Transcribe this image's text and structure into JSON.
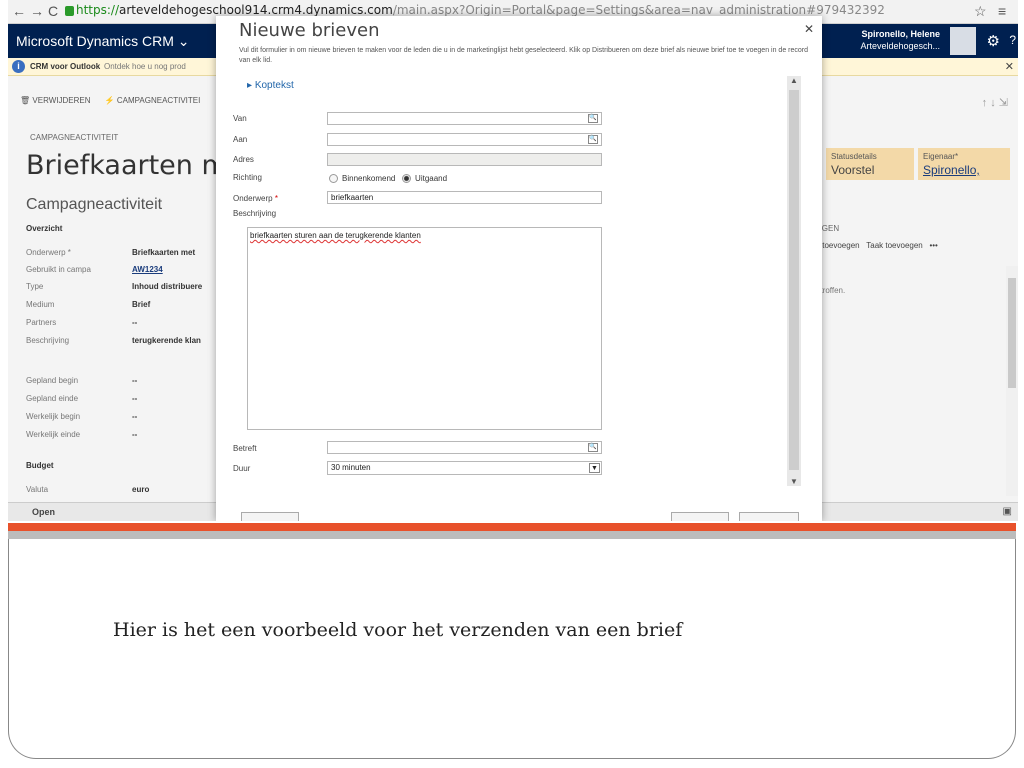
{
  "browser": {
    "url_https": "https://",
    "url_domain": "arteveldehogeschool914.crm4.dynamics.com",
    "url_rest": "/main.aspx?Origin=Portal&page=Settings&area=nav_administration#979432392"
  },
  "crm": {
    "brand": "Microsoft Dynamics CRM",
    "user_name": "Spironello, Helene",
    "user_org": "Arteveldehogesch..."
  },
  "notice": {
    "title": "CRM voor Outlook",
    "text": "Ontdek hoe u nog prod"
  },
  "record": {
    "cmd_delete": "VERWIJDEREN",
    "cmd_campaign": "CAMPAGNEACTIVITEI",
    "entity": "CAMPAGNEACTIVITEIT",
    "title": "Briefkaarten me",
    "section": "Campagneactiviteit",
    "overview": "Overzicht",
    "fields": [
      {
        "label": "Onderwerp *",
        "value": "Briefkaarten met"
      },
      {
        "label": "Gebruikt in campa",
        "value": "AW1234"
      },
      {
        "label": "Type",
        "value": "Inhoud distribuere"
      },
      {
        "label": "Medium",
        "value": "Brief"
      },
      {
        "label": "Partners",
        "value": "--"
      },
      {
        "label": "Beschrijving",
        "value": "terugkerende klan"
      },
      {
        "label": "Gepland begin",
        "value": "--"
      },
      {
        "label": "Gepland einde",
        "value": "--"
      },
      {
        "label": "Werkelijk begin",
        "value": "--"
      },
      {
        "label": "Werkelijk einde",
        "value": "--"
      }
    ],
    "budget": "Budget",
    "currency_label": "Valuta",
    "currency_value": "euro",
    "status_label": "Statusdetails",
    "status_value": "Voorstel",
    "owner_label": "Eigenaar*",
    "owner_value": "Spironello,",
    "right_section": "NGEN",
    "right_action1": "k toevoegen",
    "right_action2": "Taak toevoegen",
    "right_more": "•••",
    "right_text": "etroffen.",
    "footer_status": "Open"
  },
  "dialog": {
    "title": "Nieuwe brieven",
    "description": "Vul dit formulier in om nieuwe brieven te maken voor de leden die u in de marketinglijst hebt geselecteerd. Klik op Distribueren om deze brief als nieuwe brief toe te voegen in de record van elk lid.",
    "header_toggle": "Koptekst",
    "van": "Van",
    "aan": "Aan",
    "adres": "Adres",
    "richting": "Richting",
    "dir_in": "Binnenkomend",
    "dir_out": "Uitgaand",
    "onderwerp": "Onderwerp",
    "onderwerp_value": "briefkaarten",
    "beschrijving": "Beschrijving",
    "beschrijving_value": "briefkaarten sturen aan de terugkerende klanten",
    "betreft": "Betreft",
    "duur": "Duur",
    "duur_value": "30 minuten"
  },
  "caption": "Hier is het een voorbeeld voor het verzenden van een brief"
}
